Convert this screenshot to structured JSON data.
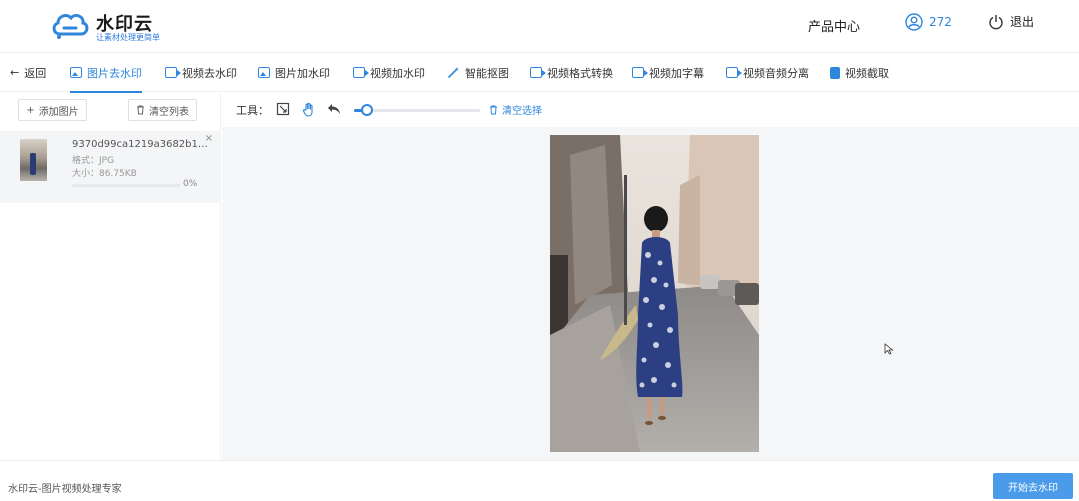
{
  "header": {
    "brand_title": "水印云",
    "brand_subtitle": "让素材处理更简单",
    "product_center": "产品中心",
    "user_count": "272",
    "logout": "退出",
    "accent_color": "#2f86dd"
  },
  "nav": {
    "back": "返回",
    "items": [
      {
        "label": "图片去水印",
        "icon": "image-icon",
        "active": true
      },
      {
        "label": "视频去水印",
        "icon": "video-icon"
      },
      {
        "label": "图片加水印",
        "icon": "image-icon"
      },
      {
        "label": "视频加水印",
        "icon": "video-icon"
      },
      {
        "label": "智能抠图",
        "icon": "magic-wand-icon"
      },
      {
        "label": "视频格式转换",
        "icon": "video-icon"
      },
      {
        "label": "视频加字幕",
        "icon": "video-icon"
      },
      {
        "label": "视频音频分离",
        "icon": "video-icon"
      },
      {
        "label": "视频截取",
        "icon": "video-icon"
      }
    ]
  },
  "left": {
    "add_image": "添加图片",
    "clear_list": "清空列表",
    "file": {
      "name": "9370d99ca1219a3682b1da70c...",
      "format_label": "格式：",
      "format": "JPG",
      "size_label": "大小：",
      "size": "86.75KB",
      "progress": "0%",
      "close": "×"
    }
  },
  "toolbar": {
    "label": "工具：",
    "clear_selection": "清空选择",
    "brush_level": 0.1
  },
  "footer": {
    "text": "水印云-图片视频处理专家",
    "start_button": "开始去水印"
  }
}
